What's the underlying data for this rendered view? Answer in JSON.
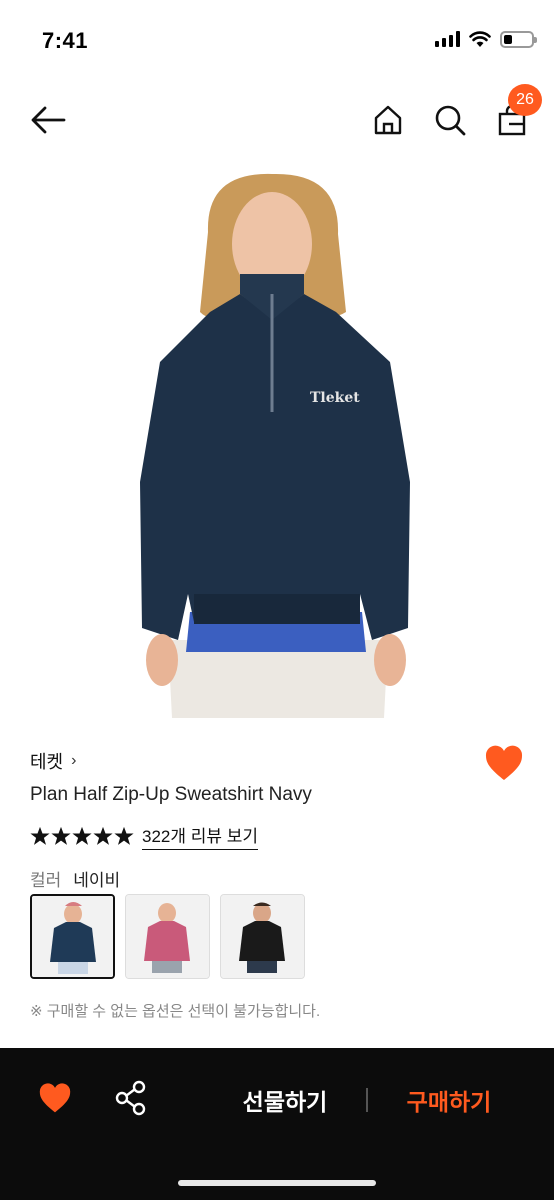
{
  "status_bar": {
    "time": "7:41"
  },
  "nav": {
    "cart_count": "26"
  },
  "product": {
    "brand": "테켓",
    "brand_chevron": "›",
    "name": "Plan Half Zip-Up Sweatshirt Navy",
    "rating": 5,
    "review_link": "322개 리뷰 보기",
    "color_label": "컬러",
    "color_value": "네이비",
    "swatches": [
      {
        "color": "navy",
        "hex": "#1f3a57",
        "selected": true
      },
      {
        "color": "pink",
        "hex": "#c95a7a",
        "selected": false
      },
      {
        "color": "black",
        "hex": "#1a1a1a",
        "selected": false
      }
    ],
    "option_note": "※ 구매할 수 없는 옵션은 선택이 불가능합니다."
  },
  "bottom_bar": {
    "gift_label": "선물하기",
    "buy_label": "구매하기"
  },
  "colors": {
    "accent": "#ff5a1f",
    "bottom_bar_bg": "#0c0c0c"
  },
  "icons": [
    "back-arrow-icon",
    "home-icon",
    "search-icon",
    "shopping-bag-icon",
    "heart-icon",
    "star-icon",
    "share-icon"
  ]
}
